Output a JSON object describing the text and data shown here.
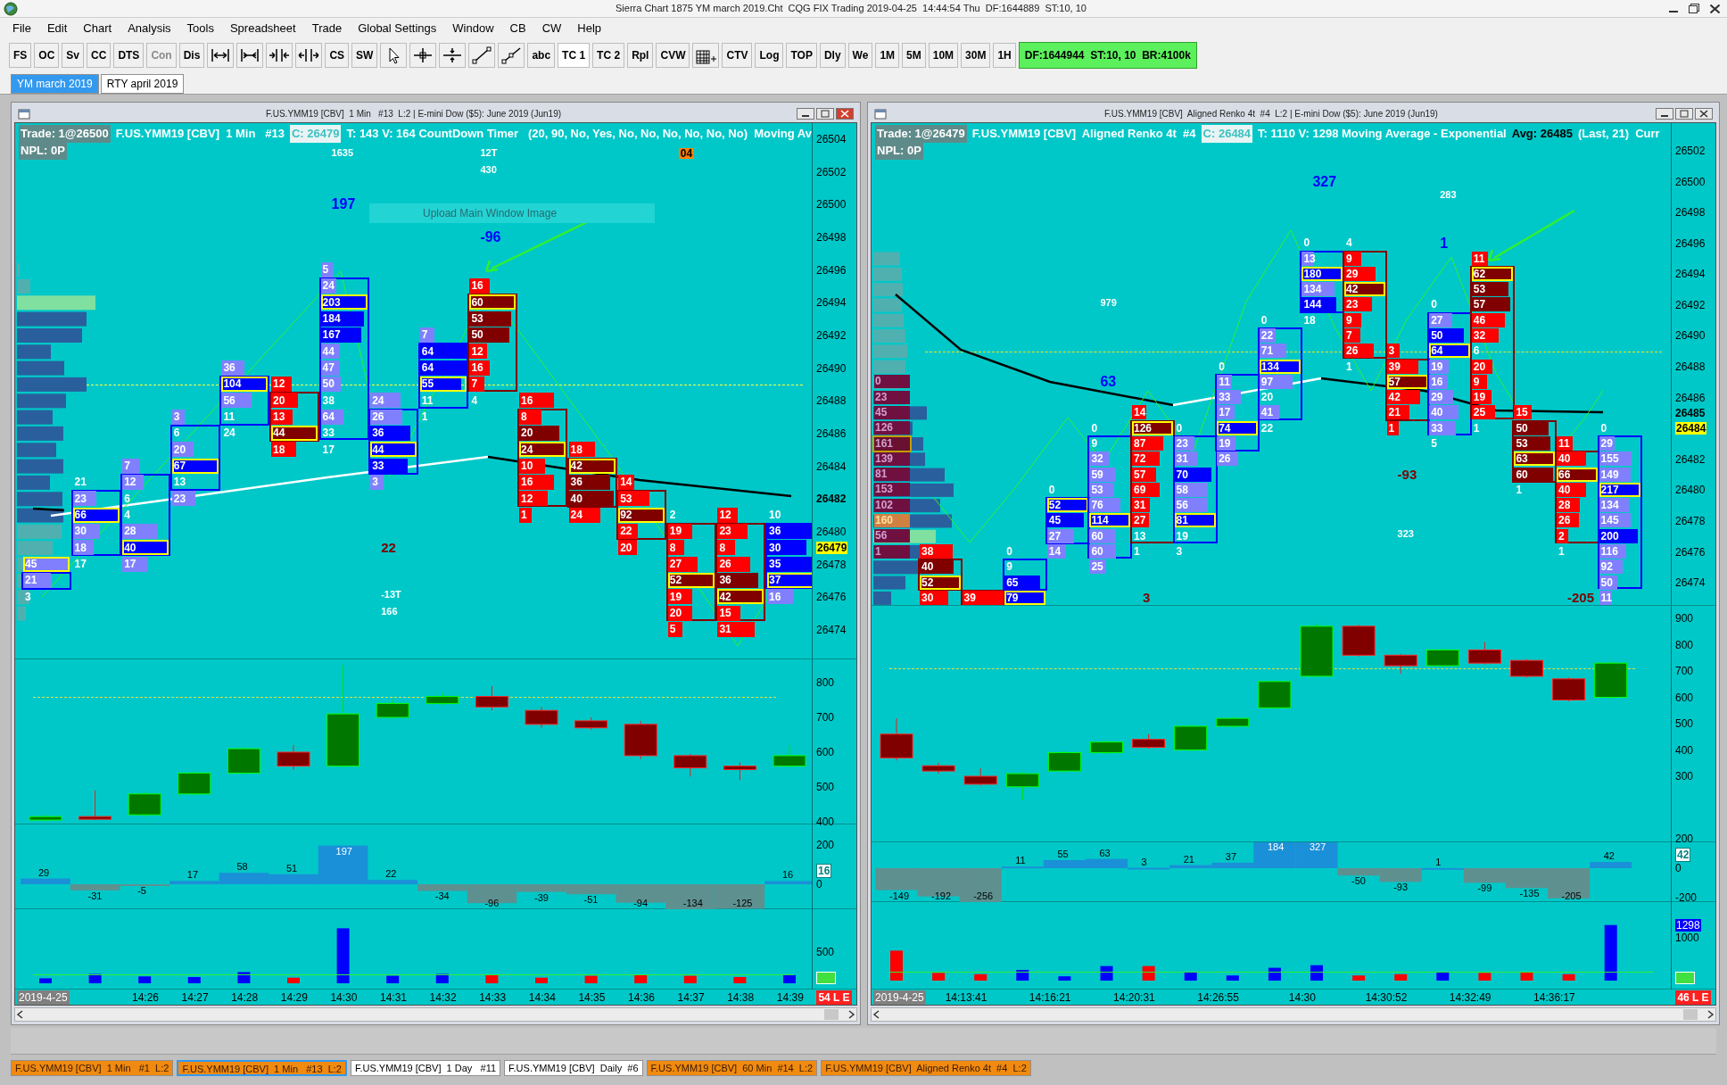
{
  "title_bar": {
    "title": "Sierra Chart 1875 YM march 2019.Cht  CQG FIX Trading 2019-04-25  14:44:54 Thu  DF:1644889  ST:10, 10"
  },
  "menu": [
    "File",
    "Edit",
    "Chart",
    "Analysis",
    "Tools",
    "Spreadsheet",
    "Trade",
    "Global Settings",
    "Window",
    "CB",
    "CW",
    "Help"
  ],
  "toolbar": {
    "items": [
      {
        "kind": "text",
        "label": "FS",
        "disabled": false,
        "selected": false
      },
      {
        "kind": "text",
        "label": "OC",
        "disabled": false,
        "selected": false
      },
      {
        "kind": "text",
        "label": "Sv",
        "disabled": false,
        "selected": false
      },
      {
        "kind": "text",
        "label": "CC",
        "disabled": false,
        "selected": false
      },
      {
        "kind": "text",
        "label": "DTS",
        "disabled": false,
        "selected": false
      },
      {
        "kind": "text",
        "label": "Con",
        "disabled": true,
        "selected": false
      },
      {
        "kind": "text",
        "label": "Dis",
        "disabled": false,
        "selected": false
      },
      {
        "kind": "spread"
      },
      {
        "kind": "spread_in"
      },
      {
        "kind": "compress"
      },
      {
        "kind": "expand"
      },
      {
        "kind": "text",
        "label": "CS",
        "disabled": false,
        "selected": false
      },
      {
        "kind": "text",
        "label": "SW",
        "disabled": false,
        "selected": false
      },
      {
        "kind": "pointer"
      },
      {
        "kind": "crosshair"
      },
      {
        "kind": "hline"
      },
      {
        "kind": "line"
      },
      {
        "kind": "ray"
      },
      {
        "kind": "text",
        "label": "abc",
        "disabled": false,
        "selected": false
      },
      {
        "kind": "text",
        "label": "TC 1",
        "disabled": false,
        "selected": true
      },
      {
        "kind": "text",
        "label": "TC 2",
        "disabled": false,
        "selected": false
      },
      {
        "kind": "text",
        "label": "Rpl",
        "disabled": false,
        "selected": false
      },
      {
        "kind": "text",
        "label": "CVW",
        "disabled": false,
        "selected": false
      },
      {
        "kind": "grid"
      },
      {
        "kind": "text",
        "label": "CTV",
        "disabled": false,
        "selected": false
      },
      {
        "kind": "text",
        "label": "Log",
        "disabled": false,
        "selected": false
      },
      {
        "kind": "text",
        "label": "TOP",
        "disabled": false,
        "selected": false
      },
      {
        "kind": "text",
        "label": "Dly",
        "disabled": false,
        "selected": false
      },
      {
        "kind": "text",
        "label": "We",
        "disabled": false,
        "selected": false
      },
      {
        "kind": "text",
        "label": "1M",
        "disabled": false,
        "selected": false
      },
      {
        "kind": "text",
        "label": "5M",
        "disabled": false,
        "selected": false
      },
      {
        "kind": "text",
        "label": "10M",
        "disabled": false,
        "selected": false
      },
      {
        "kind": "text",
        "label": "30M",
        "disabled": false,
        "selected": false
      },
      {
        "kind": "text",
        "label": "1H",
        "disabled": false,
        "selected": false
      }
    ],
    "status": "DF:1644944  ST:10, 10  BR:4100k"
  },
  "chartbook_tabs": [
    {
      "label": "YM march 2019",
      "selected": true
    },
    {
      "label": "RTY april 2019",
      "selected": false
    }
  ],
  "charts": [
    {
      "window_title": "F.US.YMM19 [CBV]  1 Min   #13  L:2 | E-mini Dow ($5): June 2019 (Jun19)",
      "header": {
        "trade": "Trade: 1@26500",
        "symbol": "F.US.YMM19 [CBV]  1 Min   #13",
        "close": "C: 26479",
        "study": "T: 143 V: 164 CountDown Timer   (20, 90, No, Yes, No, No, No, No, No, No)  Moving Av",
        "npl": "NPL: 0P"
      },
      "tooltip": "Upload Main Window Image",
      "price_axis": [
        "26504",
        "26502",
        "26500",
        "26498",
        "26496",
        "26494",
        "26492",
        "26490",
        "26488",
        "26486",
        "26484",
        "26480",
        "26478",
        "26476",
        "26474"
      ],
      "ma_price": "26482",
      "last_price": "26479",
      "columns": [
        {
          "rising": true,
          "cells": [
            {
              "value": "45",
              "kind": "lavender",
              "poc": true
            },
            {
              "value": "21",
              "kind": "lavender",
              "poc": false
            },
            {
              "value": "3",
              "kind": "plain",
              "poc": false
            }
          ]
        },
        {
          "rising": true,
          "cells": [
            {
              "value": "21",
              "kind": "plain",
              "poc": false
            },
            {
              "value": "23",
              "kind": "lavender",
              "poc": false
            },
            {
              "value": "66",
              "kind": "blue",
              "poc": true
            },
            {
              "value": "30",
              "kind": "lavender",
              "poc": false
            },
            {
              "value": "18",
              "kind": "lavender",
              "poc": false
            },
            {
              "value": "17",
              "kind": "plain",
              "poc": false
            }
          ]
        },
        {
          "rising": true,
          "cells": [
            {
              "value": "7",
              "kind": "lavender",
              "poc": false
            },
            {
              "value": "12",
              "kind": "lavender",
              "poc": false
            },
            {
              "value": "6",
              "kind": "plain",
              "poc": false
            },
            {
              "value": "4",
              "kind": "plain",
              "poc": false
            },
            {
              "value": "28",
              "kind": "lavender",
              "poc": false
            },
            {
              "value": "40",
              "kind": "blue",
              "poc": true
            },
            {
              "value": "17",
              "kind": "lavender",
              "poc": false
            }
          ]
        },
        {
          "rising": true,
          "cells": [
            {
              "value": "3",
              "kind": "lavender",
              "poc": false
            },
            {
              "value": "6",
              "kind": "plain",
              "poc": false
            },
            {
              "value": "20",
              "kind": "lavender",
              "poc": false
            },
            {
              "value": "67",
              "kind": "blue",
              "poc": true
            },
            {
              "value": "13",
              "kind": "plain",
              "poc": false
            },
            {
              "value": "23",
              "kind": "lavender",
              "poc": false
            }
          ]
        },
        {
          "rising": true,
          "cells": [
            {
              "value": "36",
              "kind": "lavender",
              "poc": false
            },
            {
              "value": "104",
              "kind": "blue",
              "poc": true
            },
            {
              "value": "56",
              "kind": "lavender",
              "poc": false
            },
            {
              "value": "11",
              "kind": "plain",
              "poc": false
            },
            {
              "value": "24",
              "kind": "plain",
              "poc": false
            }
          ]
        },
        {
          "rising": false,
          "cells": [
            {
              "value": "12",
              "kind": "red",
              "poc": false
            },
            {
              "value": "20",
              "kind": "red",
              "poc": false
            },
            {
              "value": "13",
              "kind": "red",
              "poc": false
            },
            {
              "value": "44",
              "kind": "maroon",
              "poc": true
            },
            {
              "value": "18",
              "kind": "red",
              "poc": false
            }
          ]
        },
        {
          "rising": true,
          "cells": [
            {
              "value": "5",
              "kind": "lavender",
              "poc": false
            },
            {
              "value": "24",
              "kind": "lavender",
              "poc": false
            },
            {
              "value": "203",
              "kind": "blue",
              "poc": true
            },
            {
              "value": "184",
              "kind": "blue",
              "poc": false
            },
            {
              "value": "167",
              "kind": "blue",
              "poc": false
            },
            {
              "value": "44",
              "kind": "lavender",
              "poc": false
            },
            {
              "value": "47",
              "kind": "lavender",
              "poc": false
            },
            {
              "value": "50",
              "kind": "lavender",
              "poc": false
            },
            {
              "value": "38",
              "kind": "plain",
              "poc": false
            },
            {
              "value": "64",
              "kind": "lavender",
              "poc": false
            },
            {
              "value": "33",
              "kind": "plain",
              "poc": false
            },
            {
              "value": "17",
              "kind": "plain",
              "poc": false
            }
          ]
        },
        {
          "rising": true,
          "cells": [
            {
              "value": "24",
              "kind": "lavender",
              "poc": false
            },
            {
              "value": "26",
              "kind": "lavender",
              "poc": false
            },
            {
              "value": "36",
              "kind": "blue",
              "poc": false
            },
            {
              "value": "44",
              "kind": "blue",
              "poc": true
            },
            {
              "value": "33",
              "kind": "blue",
              "poc": false
            },
            {
              "value": "3",
              "kind": "lavender",
              "poc": false
            }
          ]
        },
        {
          "rising": true,
          "cells": [
            {
              "value": "7",
              "kind": "lavender",
              "poc": false
            },
            {
              "value": "64",
              "kind": "blue",
              "poc": false
            },
            {
              "value": "64",
              "kind": "blue",
              "poc": false
            },
            {
              "value": "55",
              "kind": "blue",
              "poc": true
            },
            {
              "value": "11",
              "kind": "plain",
              "poc": false
            },
            {
              "value": "1",
              "kind": "plain",
              "poc": false
            }
          ]
        },
        {
          "rising": false,
          "cells": [
            {
              "value": "16",
              "kind": "red",
              "poc": false
            },
            {
              "value": "60",
              "kind": "maroon",
              "poc": true
            },
            {
              "value": "53",
              "kind": "maroon",
              "poc": false
            },
            {
              "value": "50",
              "kind": "maroon",
              "poc": false
            },
            {
              "value": "12",
              "kind": "red",
              "poc": false
            },
            {
              "value": "16",
              "kind": "red",
              "poc": false
            },
            {
              "value": "7",
              "kind": "red",
              "poc": false
            },
            {
              "value": "4",
              "kind": "plain",
              "poc": false
            }
          ]
        },
        {
          "rising": false,
          "cells": [
            {
              "value": "16",
              "kind": "red",
              "poc": false
            },
            {
              "value": "8",
              "kind": "red",
              "poc": false
            },
            {
              "value": "20",
              "kind": "maroon",
              "poc": false
            },
            {
              "value": "24",
              "kind": "maroon",
              "poc": true
            },
            {
              "value": "10",
              "kind": "red",
              "poc": false
            },
            {
              "value": "16",
              "kind": "red",
              "poc": false
            },
            {
              "value": "12",
              "kind": "red",
              "poc": false
            },
            {
              "value": "1",
              "kind": "red",
              "poc": false
            }
          ]
        },
        {
          "rising": false,
          "cells": [
            {
              "value": "18",
              "kind": "red",
              "poc": false
            },
            {
              "value": "42",
              "kind": "maroon",
              "poc": true
            },
            {
              "value": "36",
              "kind": "maroon",
              "poc": false
            },
            {
              "value": "40",
              "kind": "maroon",
              "poc": false
            },
            {
              "value": "24",
              "kind": "red",
              "poc": false
            }
          ]
        },
        {
          "rising": false,
          "cells": [
            {
              "value": "14",
              "kind": "red",
              "poc": false
            },
            {
              "value": "53",
              "kind": "red",
              "poc": false
            },
            {
              "value": "92",
              "kind": "maroon",
              "poc": true
            },
            {
              "value": "22",
              "kind": "red",
              "poc": false
            },
            {
              "value": "20",
              "kind": "red",
              "poc": false
            }
          ]
        },
        {
          "rising": false,
          "cells": [
            {
              "value": "2",
              "kind": "plain",
              "poc": false
            },
            {
              "value": "19",
              "kind": "red",
              "poc": false
            },
            {
              "value": "8",
              "kind": "red",
              "poc": false
            },
            {
              "value": "27",
              "kind": "red",
              "poc": false
            },
            {
              "value": "52",
              "kind": "maroon",
              "poc": true
            },
            {
              "value": "19",
              "kind": "red",
              "poc": false
            },
            {
              "value": "20",
              "kind": "red",
              "poc": false
            },
            {
              "value": "5",
              "kind": "red",
              "poc": false
            }
          ]
        },
        {
          "rising": false,
          "cells": [
            {
              "value": "12",
              "kind": "red",
              "poc": false
            },
            {
              "value": "23",
              "kind": "red",
              "poc": false
            },
            {
              "value": "8",
              "kind": "red",
              "poc": false
            },
            {
              "value": "26",
              "kind": "red",
              "poc": false
            },
            {
              "value": "36",
              "kind": "maroon",
              "poc": false
            },
            {
              "value": "42",
              "kind": "maroon",
              "poc": true
            },
            {
              "value": "15",
              "kind": "red",
              "poc": false
            },
            {
              "value": "31",
              "kind": "red",
              "poc": false
            }
          ]
        },
        {
          "rising": true,
          "cells": [
            {
              "value": "10",
              "kind": "plain",
              "poc": false
            },
            {
              "value": "36",
              "kind": "blue",
              "poc": false
            },
            {
              "value": "30",
              "kind": "blue",
              "poc": false
            },
            {
              "value": "35",
              "kind": "blue",
              "poc": false
            },
            {
              "value": "37",
              "kind": "blue",
              "poc": true
            },
            {
              "value": "16",
              "kind": "lavender",
              "poc": false
            }
          ]
        }
      ],
      "annotations": [
        {
          "text": "1635",
          "kind": "white"
        },
        {
          "text": "12T",
          "kind": "white"
        },
        {
          "text": "430",
          "kind": "white"
        },
        {
          "text": "04",
          "kind": "badge"
        },
        {
          "text": "197",
          "kind": "blue"
        },
        {
          "text": "-96",
          "kind": "blue"
        },
        {
          "text": "22",
          "kind": "maroon"
        },
        {
          "text": "-13T",
          "kind": "white"
        },
        {
          "text": "166",
          "kind": "white"
        }
      ],
      "candle_axis": [
        "800",
        "700",
        "600",
        "500",
        "400"
      ],
      "delta_axis": [
        "200",
        "0"
      ],
      "delta_badge": "16",
      "delta_labels": [
        "29",
        "-31",
        "-5",
        "17",
        "58",
        "51",
        "197",
        "22",
        "-34",
        "-96",
        "-39",
        "-51",
        "-94",
        "-134",
        "-125",
        "16"
      ],
      "volume_axis": [
        "500"
      ],
      "date": "2019-4-25",
      "times": [
        "14:26",
        "14:27",
        "14:28",
        "14:29",
        "14:30",
        "14:31",
        "14:32",
        "14:33",
        "14:34",
        "14:35",
        "14:36",
        "14:37",
        "14:38",
        "14:39"
      ],
      "status_badge": "54 L E"
    },
    {
      "window_title": "F.US.YMM19 [CBV]  Aligned Renko 4t  #4  L:2 | E-mini Dow ($5): June 2019 (Jun19)",
      "header": {
        "trade": "Trade: 1@26479",
        "symbol": "F.US.YMM19 [CBV]  Aligned Renko 4t  #4",
        "close": "C: 26484",
        "study": "T: 1110 V: 1298 Moving Average - Exponential",
        "avg": "Avg: 26485",
        "extra": "(Last, 21)  Curr",
        "npl": "NPL: 0P"
      },
      "price_axis": [
        "26502",
        "26500",
        "26498",
        "26496",
        "26494",
        "26492",
        "26490",
        "26488",
        "26486",
        "26482",
        "26480",
        "26478",
        "26476",
        "26474"
      ],
      "ma_price": "26485",
      "last_price": "26484",
      "columns": [
        {
          "rising": false,
          "cells": [
            {
              "value": "38",
              "kind": "red",
              "poc": false
            },
            {
              "value": "40",
              "kind": "maroon",
              "poc": false
            },
            {
              "value": "52",
              "kind": "maroon",
              "poc": true
            },
            {
              "value": "30",
              "kind": "red",
              "poc": false
            }
          ]
        },
        {
          "rising": false,
          "cells": [
            {
              "value": "39",
              "kind": "red",
              "poc": false
            }
          ]
        },
        {
          "rising": true,
          "cells": [
            {
              "value": "0",
              "kind": "plain",
              "poc": false
            },
            {
              "value": "9",
              "kind": "plain",
              "poc": false
            },
            {
              "value": "65",
              "kind": "blue",
              "poc": false
            },
            {
              "value": "79",
              "kind": "blue",
              "poc": true
            }
          ]
        },
        {
          "rising": true,
          "cells": [
            {
              "value": "0",
              "kind": "plain",
              "poc": false
            },
            {
              "value": "52",
              "kind": "blue",
              "poc": true
            },
            {
              "value": "45",
              "kind": "blue",
              "poc": false
            },
            {
              "value": "27",
              "kind": "lavender",
              "poc": false
            },
            {
              "value": "14",
              "kind": "lavender",
              "poc": false
            }
          ]
        },
        {
          "rising": true,
          "cells": [
            {
              "value": "0",
              "kind": "plain",
              "poc": false
            },
            {
              "value": "9",
              "kind": "plain",
              "poc": false
            },
            {
              "value": "32",
              "kind": "lavender",
              "poc": false
            },
            {
              "value": "59",
              "kind": "lavender",
              "poc": false
            },
            {
              "value": "53",
              "kind": "lavender",
              "poc": false
            },
            {
              "value": "76",
              "kind": "lavender",
              "poc": false
            },
            {
              "value": "114",
              "kind": "blue",
              "poc": true
            },
            {
              "value": "60",
              "kind": "lavender",
              "poc": false
            },
            {
              "value": "60",
              "kind": "lavender",
              "poc": false
            },
            {
              "value": "25",
              "kind": "lavender",
              "poc": false
            }
          ]
        },
        {
          "rising": false,
          "cells": [
            {
              "value": "14",
              "kind": "red",
              "poc": false
            },
            {
              "value": "126",
              "kind": "maroon",
              "poc": true
            },
            {
              "value": "87",
              "kind": "red",
              "poc": false
            },
            {
              "value": "72",
              "kind": "red",
              "poc": false
            },
            {
              "value": "57",
              "kind": "red",
              "poc": false
            },
            {
              "value": "69",
              "kind": "red",
              "poc": false
            },
            {
              "value": "31",
              "kind": "red",
              "poc": false
            },
            {
              "value": "27",
              "kind": "red",
              "poc": false
            },
            {
              "value": "13",
              "kind": "plain",
              "poc": false
            },
            {
              "value": "1",
              "kind": "plain",
              "poc": false
            }
          ]
        },
        {
          "rising": true,
          "cells": [
            {
              "value": "0",
              "kind": "plain",
              "poc": false
            },
            {
              "value": "23",
              "kind": "lavender",
              "poc": false
            },
            {
              "value": "31",
              "kind": "lavender",
              "poc": false
            },
            {
              "value": "70",
              "kind": "blue",
              "poc": false
            },
            {
              "value": "58",
              "kind": "lavender",
              "poc": false
            },
            {
              "value": "56",
              "kind": "lavender",
              "poc": false
            },
            {
              "value": "81",
              "kind": "blue",
              "poc": true
            },
            {
              "value": "19",
              "kind": "plain",
              "poc": false
            },
            {
              "value": "3",
              "kind": "plain",
              "poc": false
            }
          ]
        },
        {
          "rising": true,
          "cells": [
            {
              "value": "0",
              "kind": "plain",
              "poc": false
            },
            {
              "value": "11",
              "kind": "lavender",
              "poc": false
            },
            {
              "value": "33",
              "kind": "lavender",
              "poc": false
            },
            {
              "value": "17",
              "kind": "lavender",
              "poc": false
            },
            {
              "value": "74",
              "kind": "blue",
              "poc": true
            },
            {
              "value": "19",
              "kind": "lavender",
              "poc": false
            },
            {
              "value": "26",
              "kind": "lavender",
              "poc": false
            }
          ]
        },
        {
          "rising": true,
          "cells": [
            {
              "value": "0",
              "kind": "plain",
              "poc": false
            },
            {
              "value": "22",
              "kind": "lavender",
              "poc": false
            },
            {
              "value": "71",
              "kind": "lavender",
              "poc": false
            },
            {
              "value": "134",
              "kind": "blue",
              "poc": true
            },
            {
              "value": "97",
              "kind": "lavender",
              "poc": false
            },
            {
              "value": "20",
              "kind": "plain",
              "poc": false
            },
            {
              "value": "41",
              "kind": "lavender",
              "poc": false
            },
            {
              "value": "22",
              "kind": "plain",
              "poc": false
            }
          ]
        },
        {
          "rising": true,
          "cells": [
            {
              "value": "0",
              "kind": "plain",
              "poc": false
            },
            {
              "value": "13",
              "kind": "lavender",
              "poc": false
            },
            {
              "value": "180",
              "kind": "blue",
              "poc": true
            },
            {
              "value": "134",
              "kind": "lavender",
              "poc": false
            },
            {
              "value": "144",
              "kind": "blue",
              "poc": false
            },
            {
              "value": "18",
              "kind": "plain",
              "poc": false
            }
          ]
        },
        {
          "rising": false,
          "cells": [
            {
              "value": "4",
              "kind": "plain",
              "poc": false
            },
            {
              "value": "9",
              "kind": "red",
              "poc": false
            },
            {
              "value": "29",
              "kind": "red",
              "poc": false
            },
            {
              "value": "42",
              "kind": "maroon",
              "poc": true
            },
            {
              "value": "23",
              "kind": "red",
              "poc": false
            },
            {
              "value": "9",
              "kind": "red",
              "poc": false
            },
            {
              "value": "7",
              "kind": "red",
              "poc": false
            },
            {
              "value": "26",
              "kind": "red",
              "poc": false
            },
            {
              "value": "1",
              "kind": "plain",
              "poc": false
            }
          ]
        },
        {
          "rising": false,
          "cells": [
            {
              "value": "3",
              "kind": "red",
              "poc": false
            },
            {
              "value": "39",
              "kind": "red",
              "poc": false
            },
            {
              "value": "57",
              "kind": "maroon",
              "poc": true
            },
            {
              "value": "42",
              "kind": "red",
              "poc": false
            },
            {
              "value": "21",
              "kind": "red",
              "poc": false
            },
            {
              "value": "1",
              "kind": "red",
              "poc": false
            }
          ]
        },
        {
          "rising": true,
          "cells": [
            {
              "value": "0",
              "kind": "plain",
              "poc": false
            },
            {
              "value": "27",
              "kind": "lavender",
              "poc": false
            },
            {
              "value": "50",
              "kind": "blue",
              "poc": false
            },
            {
              "value": "64",
              "kind": "blue",
              "poc": true
            },
            {
              "value": "19",
              "kind": "lavender",
              "poc": false
            },
            {
              "value": "16",
              "kind": "lavender",
              "poc": false
            },
            {
              "value": "29",
              "kind": "lavender",
              "poc": false
            },
            {
              "value": "40",
              "kind": "lavender",
              "poc": false
            },
            {
              "value": "33",
              "kind": "lavender",
              "poc": false
            },
            {
              "value": "5",
              "kind": "plain",
              "poc": false
            }
          ]
        },
        {
          "rising": false,
          "cells": [
            {
              "value": "11",
              "kind": "red",
              "poc": false
            },
            {
              "value": "62",
              "kind": "maroon",
              "poc": true
            },
            {
              "value": "53",
              "kind": "maroon",
              "poc": false
            },
            {
              "value": "57",
              "kind": "maroon",
              "poc": false
            },
            {
              "value": "46",
              "kind": "red",
              "poc": false
            },
            {
              "value": "32",
              "kind": "red",
              "poc": false
            },
            {
              "value": "6",
              "kind": "plain",
              "poc": false
            },
            {
              "value": "20",
              "kind": "red",
              "poc": false
            },
            {
              "value": "9",
              "kind": "red",
              "poc": false
            },
            {
              "value": "19",
              "kind": "red",
              "poc": false
            },
            {
              "value": "25",
              "kind": "red",
              "poc": false
            },
            {
              "value": "1",
              "kind": "plain",
              "poc": false
            }
          ]
        },
        {
          "rising": false,
          "cells": [
            {
              "value": "15",
              "kind": "red",
              "poc": false
            },
            {
              "value": "50",
              "kind": "maroon",
              "poc": false
            },
            {
              "value": "53",
              "kind": "maroon",
              "poc": false
            },
            {
              "value": "63",
              "kind": "maroon",
              "poc": true
            },
            {
              "value": "60",
              "kind": "maroon",
              "poc": false
            },
            {
              "value": "1",
              "kind": "plain",
              "poc": false
            }
          ]
        },
        {
          "rising": false,
          "cells": [
            {
              "value": "11",
              "kind": "red",
              "poc": false
            },
            {
              "value": "40",
              "kind": "red",
              "poc": false
            },
            {
              "value": "66",
              "kind": "maroon",
              "poc": true
            },
            {
              "value": "40",
              "kind": "red",
              "poc": false
            },
            {
              "value": "28",
              "kind": "red",
              "poc": false
            },
            {
              "value": "26",
              "kind": "red",
              "poc": false
            },
            {
              "value": "2",
              "kind": "red",
              "poc": false
            },
            {
              "value": "1",
              "kind": "plain",
              "poc": false
            }
          ]
        },
        {
          "rising": true,
          "cells": [
            {
              "value": "0",
              "kind": "plain",
              "poc": false
            },
            {
              "value": "29",
              "kind": "lavender",
              "poc": false
            },
            {
              "value": "155",
              "kind": "lavender",
              "poc": false
            },
            {
              "value": "149",
              "kind": "lavender",
              "poc": false
            },
            {
              "value": "217",
              "kind": "blue",
              "poc": true
            },
            {
              "value": "134",
              "kind": "lavender",
              "poc": false
            },
            {
              "value": "145",
              "kind": "lavender",
              "poc": false
            },
            {
              "value": "200",
              "kind": "blue",
              "poc": false
            },
            {
              "value": "116",
              "kind": "lavender",
              "poc": false
            },
            {
              "value": "92",
              "kind": "lavender",
              "poc": false
            },
            {
              "value": "50",
              "kind": "lavender",
              "poc": false
            },
            {
              "value": "11",
              "kind": "lavender",
              "poc": false
            }
          ]
        }
      ],
      "annotations": [
        {
          "text": "327",
          "kind": "blue"
        },
        {
          "text": "283",
          "kind": "white"
        },
        {
          "text": "1",
          "kind": "blue"
        },
        {
          "text": "979",
          "kind": "white"
        },
        {
          "text": "63",
          "kind": "blue"
        },
        {
          "text": "-93",
          "kind": "maroon"
        },
        {
          "text": "323",
          "kind": "white"
        },
        {
          "text": "3",
          "kind": "maroon"
        },
        {
          "text": "-205",
          "kind": "maroon"
        }
      ],
      "profile_labels": [
        {
          "value": "0",
          "kind": "normal"
        },
        {
          "value": "23",
          "kind": "normal"
        },
        {
          "value": "45",
          "kind": "normal"
        },
        {
          "value": "126",
          "kind": "normal"
        },
        {
          "value": "161",
          "kind": "outlined"
        },
        {
          "value": "139",
          "kind": "normal"
        },
        {
          "value": "81",
          "kind": "normal"
        },
        {
          "value": "153",
          "kind": "normal"
        },
        {
          "value": "102",
          "kind": "normal"
        },
        {
          "value": "160",
          "kind": "peak"
        },
        {
          "value": "56",
          "kind": "normal"
        },
        {
          "value": "1",
          "kind": "normal"
        }
      ],
      "candle_axis": [
        "900",
        "800",
        "700",
        "600",
        "500",
        "400",
        "300"
      ],
      "delta_axis": [
        "200",
        "0",
        "-200"
      ],
      "delta_badge": "42",
      "delta_labels": [
        "-149",
        "-192",
        "-256",
        "11",
        "55",
        "63",
        "3",
        "21",
        "37",
        "184",
        "327",
        "-50",
        "-93",
        "1",
        "-99",
        "-135",
        "-205",
        "42"
      ],
      "volume_axis": [
        "1000"
      ],
      "volume_badge": "1298",
      "date": "2019-4-25",
      "times": [
        "14:13:41",
        "14:16:21",
        "14:20:31",
        "14:26:55",
        "14:30",
        "14:30:52",
        "14:32:49",
        "14:36:17"
      ],
      "status_badge": "46 L E"
    }
  ],
  "bottom_tabs": [
    {
      "label": "F.US.YMM19 [CBV]  1 Min   #1  L:2",
      "highlighted": true,
      "selected": false
    },
    {
      "label": "F.US.YMM19 [CBV]  1 Min   #13  L:2",
      "highlighted": true,
      "selected": true
    },
    {
      "label": "F.US.YMM19 [CBV]  1 Day   #11",
      "highlighted": false,
      "selected": false
    },
    {
      "label": "F.US.YMM19 [CBV]  Daily  #6",
      "highlighted": false,
      "selected": false
    },
    {
      "label": "F.US.YMM19 [CBV]  60 Min  #14  L:2",
      "highlighted": true,
      "selected": false
    },
    {
      "label": "F.US.YMM19 [CBV]  Aligned Renko 4t  #4  L:2",
      "highlighted": true,
      "selected": false
    }
  ]
}
